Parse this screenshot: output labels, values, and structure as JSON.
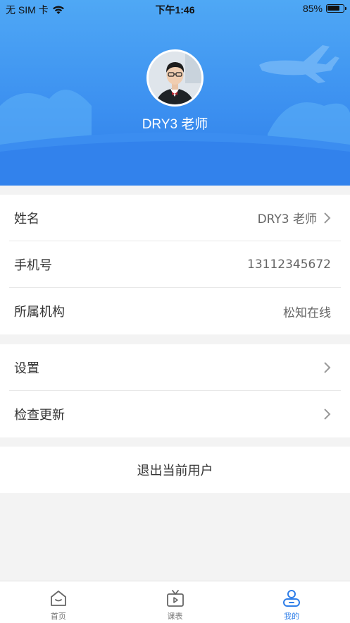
{
  "status_bar": {
    "carrier": "无 SIM 卡",
    "time": "下午1:46",
    "battery_text": "85%",
    "battery_level": 0.85
  },
  "profile": {
    "name": "DRY3 老师"
  },
  "info_rows": [
    {
      "label": "姓名",
      "value": "DRY3 老师",
      "has_chevron": true
    },
    {
      "label": "手机号",
      "value": "13112345672",
      "has_chevron": false
    },
    {
      "label": "所属机构",
      "value": "松知在线",
      "has_chevron": false
    }
  ],
  "settings_rows": [
    {
      "label": "设置",
      "has_chevron": true
    },
    {
      "label": "检查更新",
      "has_chevron": true
    }
  ],
  "logout_label": "退出当前用户",
  "tabs": [
    {
      "label": "首页",
      "icon": "home-icon",
      "active": false
    },
    {
      "label": "课表",
      "icon": "tv-schedule-icon",
      "active": false
    },
    {
      "label": "我的",
      "icon": "user-icon",
      "active": true
    }
  ],
  "colors": {
    "accent": "#2f7ee8",
    "header_top": "#4fa8f5",
    "background": "#f3f3f3"
  }
}
